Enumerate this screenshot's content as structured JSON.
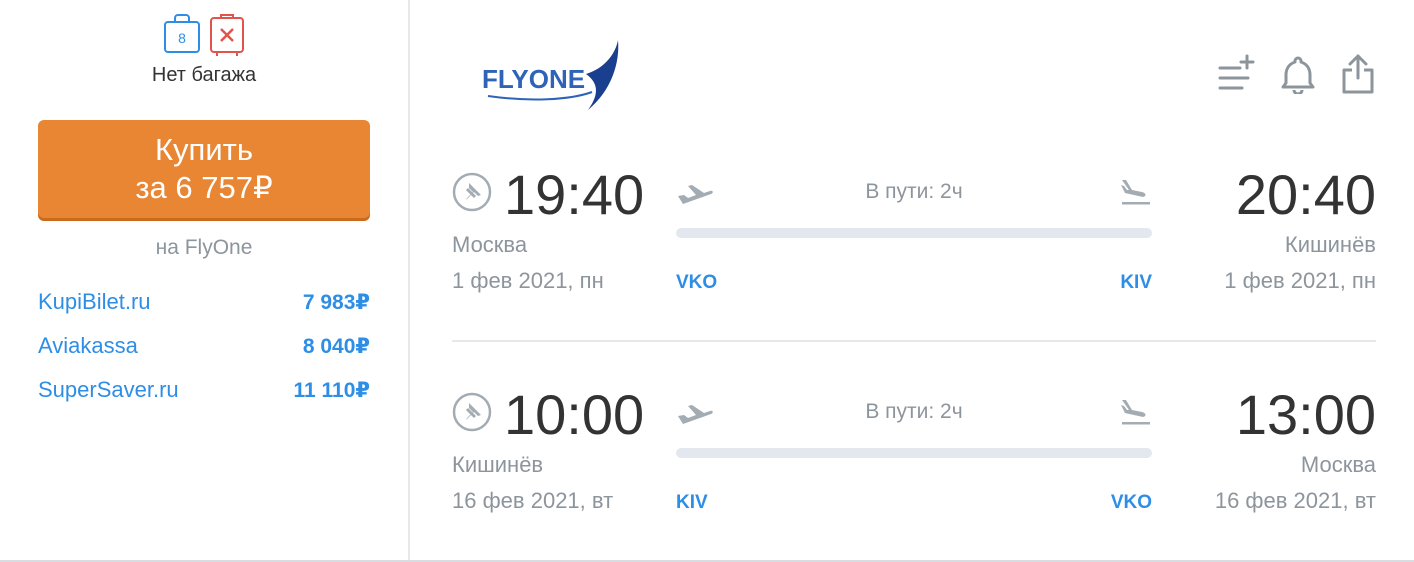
{
  "baggage": {
    "hand_count": "8",
    "label": "Нет багажа"
  },
  "buy": {
    "line1": "Купить",
    "line2": "за 6 757₽",
    "via": "на FlyOne"
  },
  "offers": [
    {
      "name": "KupiBilet.ru",
      "price": "7 983₽"
    },
    {
      "name": "Aviakassa",
      "price": "8 040₽"
    },
    {
      "name": "SuperSaver.ru",
      "price": "11 110₽"
    }
  ],
  "airline": {
    "name": "FLYONE"
  },
  "segments": [
    {
      "dep_time": "19:40",
      "dep_city": "Москва",
      "dep_date": "1 фев 2021, пн",
      "dep_code": "VKO",
      "arr_time": "20:40",
      "arr_city": "Кишинёв",
      "arr_date": "1 фев 2021, пн",
      "arr_code": "KIV",
      "duration": "В пути: 2ч"
    },
    {
      "dep_time": "10:00",
      "dep_city": "Кишинёв",
      "dep_date": "16 фев 2021, вт",
      "dep_code": "KIV",
      "arr_time": "13:00",
      "arr_city": "Москва",
      "arr_date": "16 фев 2021, вт",
      "arr_code": "VKO",
      "duration": "В пути: 2ч"
    }
  ],
  "colors": {
    "accent_orange": "#e88633",
    "link_blue": "#2e8ee6",
    "muted_gray": "#8d959c",
    "logo_navy": "#1b3f8f"
  }
}
